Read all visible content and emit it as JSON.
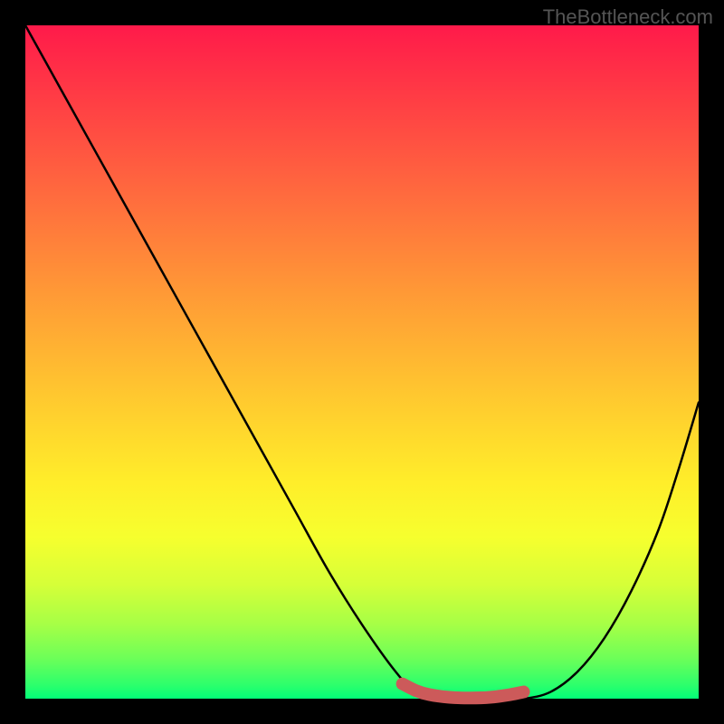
{
  "watermark": "TheBottleneck.com",
  "chart_data": {
    "type": "line",
    "title": "",
    "xlabel": "",
    "ylabel": "",
    "xlim": [
      0,
      100
    ],
    "ylim": [
      0,
      100
    ],
    "series": [
      {
        "name": "main-curve",
        "color": "#000000",
        "x": [
          0,
          5,
          10,
          15,
          20,
          25,
          30,
          35,
          40,
          45,
          50,
          55,
          58,
          62,
          66,
          70,
          74,
          78,
          82,
          86,
          90,
          94,
          97,
          100
        ],
        "values": [
          100,
          91,
          82,
          73,
          64,
          55,
          46,
          37,
          28,
          19,
          11,
          4,
          1,
          0,
          0,
          0,
          0,
          1,
          4,
          9,
          16,
          25,
          34,
          44
        ]
      },
      {
        "name": "highlight-segment",
        "color": "#cc5a5a",
        "x": [
          56,
          58,
          60,
          63,
          66,
          69,
          72,
          74
        ],
        "values": [
          2.2,
          1.2,
          0.6,
          0.2,
          0.1,
          0.2,
          0.6,
          1.0
        ]
      }
    ]
  }
}
